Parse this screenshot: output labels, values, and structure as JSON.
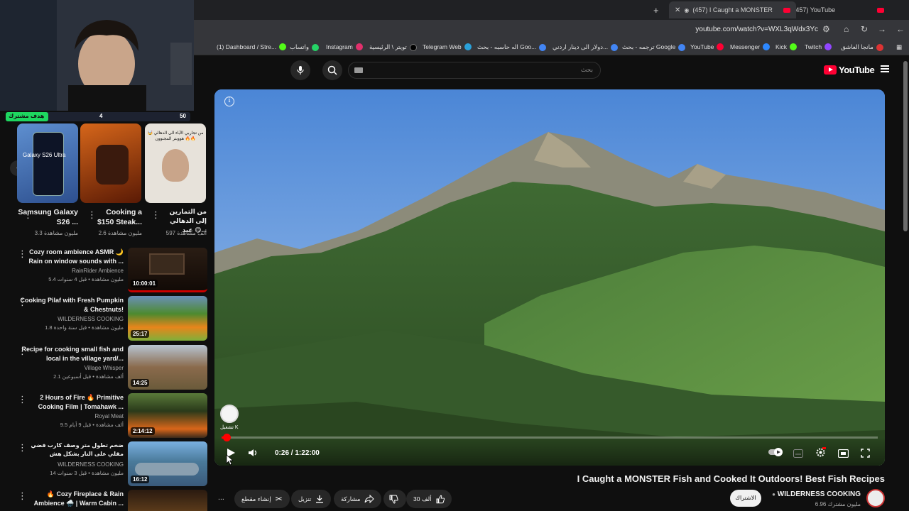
{
  "browser": {
    "tabs": [
      {
        "title": "(457) I Caught a MONSTER",
        "active": true
      },
      {
        "title": "(457) YouTube",
        "active": false
      }
    ],
    "new_tab_symbol": "+",
    "url": "youtube.com/watch?v=WXL3qWdx3Yc",
    "bookmarks": [
      {
        "label": "مانجا العاشق",
        "color": "#d33"
      },
      {
        "label": "Twitch",
        "color": "#9146ff"
      },
      {
        "label": "Kick",
        "color": "#53fc18"
      },
      {
        "label": "Messenger",
        "color": "#2d88ff"
      },
      {
        "label": "YouTube",
        "color": "#ff0033"
      },
      {
        "label": "ترجمه - بحث Google",
        "color": "#4285f4"
      },
      {
        "label": "دولار الى دينار اردني...",
        "color": "#4285f4"
      },
      {
        "label": "اله حاسبه - بحث Goo...",
        "color": "#4285f4"
      },
      {
        "label": "Telegram Web",
        "color": "#2aa1da"
      },
      {
        "label": "تويتر \\ الرئيسية",
        "color": "#000"
      },
      {
        "label": "Instagram",
        "color": "#e1306c"
      },
      {
        "label": "واتساب",
        "color": "#25d366"
      },
      {
        "label": "(1) Dashboard / Stre...",
        "color": "#53fc18"
      }
    ]
  },
  "masthead": {
    "logo_text": "YouTube",
    "search_placeholder": "بحث"
  },
  "player": {
    "time_current": "0:26",
    "time_total": "1:22:00",
    "progress": 0.0053,
    "watermark_text": "تشغيل K"
  },
  "video": {
    "title": "I Caught a MONSTER Fish and Cooked It Outdoors! Best Fish Recipes",
    "channel": "WILDERNESS COOKING",
    "subscribers": "6.96 مليون مشترك",
    "subscribe_label": "الاشتراك",
    "actions": {
      "likes": "30 ألف",
      "share": "مشاركة",
      "download": "تنزيل",
      "clip": "إنشاء مقطع",
      "more": "⋯"
    }
  },
  "stream_overlay": {
    "goal_label": "هدف مشترك",
    "goal_current": "4",
    "goal_target": "50",
    "goal_fraction": 0.08
  },
  "shorts": [
    {
      "title": "Samsung Galaxy S26 ...",
      "views": "3.3 مليون مشاهدة",
      "thumb_text": "Galaxy S26 Ultra"
    },
    {
      "title": "Cooking a $150 Steak...",
      "views": "2.6 مليون مشاهدة",
      "thumb_text": ""
    },
    {
      "title": "من التمارين إلى الدهالي 😋 عيد...",
      "views": "597 ألف مشاهدة",
      "thumb_text": "من تجاربي الآباء الى الدهالي 🤯 هووبتر المجنوون 🔥🔥"
    }
  ],
  "recommendations": [
    {
      "title": "Cozy room ambience ASMR 🌙 Rain on window sounds with ...",
      "channel": "RainRider Ambience",
      "meta": "5.4 مليون مشاهدة • قبل 4 سنوات",
      "duration": "10:00:01"
    },
    {
      "title": "Cooking Pilaf with Fresh Pumpkin & Chestnuts!",
      "channel": "WILDERNESS COOKING",
      "meta": "1.8 مليون مشاهدة • قبل سنة واحدة",
      "duration": "25:17"
    },
    {
      "title": "Recipe for cooking small fish and local in the village yard/...",
      "channel": "Village Whisper",
      "meta": "2.1 ألف مشاهدة • قبل أسبوعين",
      "duration": "14:25"
    },
    {
      "title": "2 Hours of Fire 🔥 Primitive Cooking Film | Tomahawk ...",
      "channel": "Royal Meat",
      "meta": "9.5 ألف مشاهدة • قبل 9 أيام",
      "duration": "2:14:12"
    },
    {
      "title": "ضخم تطول متر وصف كارب فضي مقلي على النار بشكل هش",
      "channel": "WILDERNESS COOKING",
      "meta": "14 مليون مشاهدة • قبل 3 سنوات",
      "duration": "16:12"
    },
    {
      "title": "🔥 Cozy Fireplace & Rain Ambience 🌧️ | Warm Cabin ...",
      "channel": "",
      "meta": "",
      "duration": ""
    }
  ]
}
